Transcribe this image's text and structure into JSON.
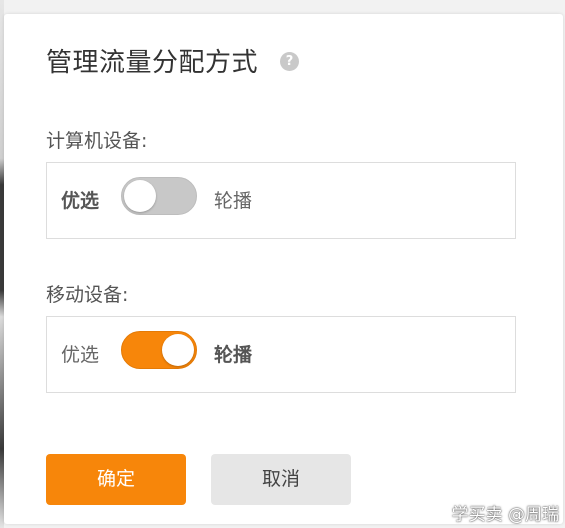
{
  "dialog": {
    "title": "管理流量分配方式",
    "help_icon": "question-circle-icon",
    "help_glyph": "?"
  },
  "computer": {
    "label": "计算机设备:",
    "option_left": "优选",
    "option_right": "轮播",
    "toggle_state": "off",
    "selected": "优选"
  },
  "mobile": {
    "label": "移动设备:",
    "option_left": "优选",
    "option_right": "轮播",
    "toggle_state": "on",
    "selected": "轮播"
  },
  "buttons": {
    "confirm": "确定",
    "cancel": "取消"
  },
  "watermark": "学买卖 @周瑞",
  "colors": {
    "accent": "#f7860a",
    "toggle_off": "#c8c8c8",
    "cancel_bg": "#e6e6e6"
  }
}
